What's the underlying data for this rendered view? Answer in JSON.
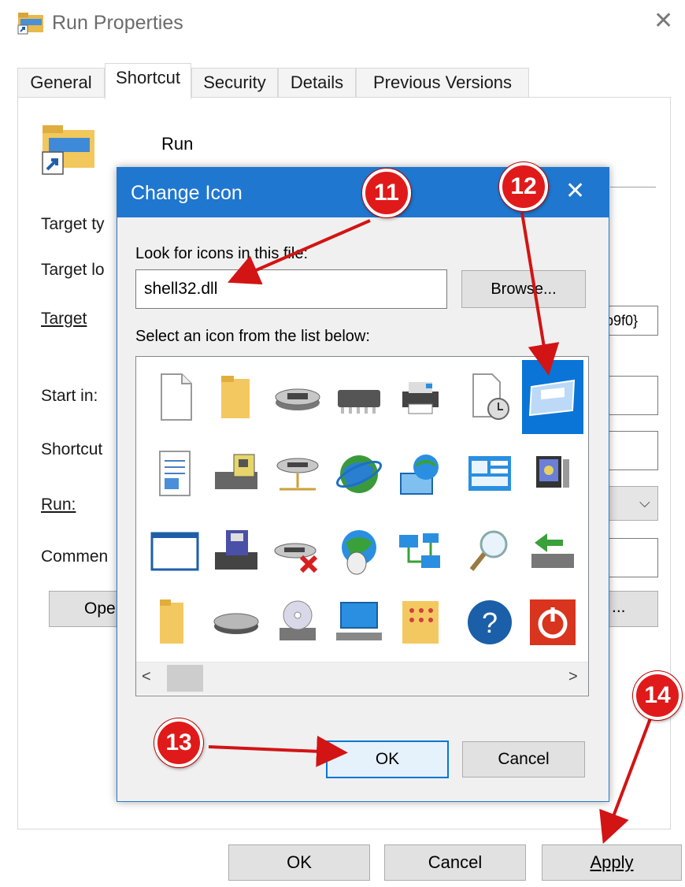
{
  "window": {
    "title": "Run Properties",
    "close_glyph": "✕",
    "tabs": [
      {
        "label": "General",
        "active": false
      },
      {
        "label": "Shortcut",
        "active": true
      },
      {
        "label": "Security",
        "active": false
      },
      {
        "label": "Details",
        "active": false
      },
      {
        "label": "Previous Versions",
        "active": false
      }
    ],
    "shortcut_name": "Run",
    "fields": {
      "target_type": "Target ty",
      "target_location": "Target lo",
      "target": "Target",
      "start_in": "Start in:",
      "shortcut_key": "Shortcut ",
      "run": "Run:",
      "comment": "Commen"
    },
    "target_value_tail": "b9f0}",
    "open_file_location_btn": "Ope",
    "change_icon_btn_tail": "...",
    "buttons": {
      "ok": "OK",
      "cancel": "Cancel",
      "apply": "Apply"
    }
  },
  "dialog": {
    "title": "Change Icon",
    "close_glyph": "✕",
    "lookfor_label": "Look for icons in this file:",
    "file_value": "shell32.dll",
    "browse_label": "Browse...",
    "select_label": "Select an icon from the list below:",
    "icons": [
      [
        "blank-document-icon",
        "folder-icon",
        "disk-drive-icon",
        "memory-chip-icon",
        "printer-icon",
        "document-clock-icon",
        "window-app-icon"
      ],
      [
        "text-document-icon",
        "floppy-drive-icon",
        "network-drive-icon",
        "globe-icon",
        "network-globe-icon",
        "control-panel-icon",
        "computer-screen-icon"
      ],
      [
        "empty-window-icon",
        "floppy-save-icon",
        "disconnected-drive-icon",
        "internet-mouse-icon",
        "network-connections-icon",
        "magnifier-icon",
        "green-arrow-drive-icon"
      ],
      [
        "folder-tall-icon",
        "flat-drive-icon",
        "cd-drive-icon",
        "monitor-icon",
        "folder-grid-icon",
        "help-icon",
        "power-icon"
      ]
    ],
    "selected_icon": "window-app-icon",
    "scroll_left": "<",
    "scroll_right": ">",
    "ok_label": "OK",
    "cancel_label": "Cancel"
  },
  "annotations": [
    {
      "number": "11",
      "color": "#e01a1a"
    },
    {
      "number": "12",
      "color": "#e01a1a"
    },
    {
      "number": "13",
      "color": "#e01a1a"
    },
    {
      "number": "14",
      "color": "#e01a1a"
    }
  ],
  "colors": {
    "accent": "#1f77cf",
    "selection": "#0a75d6",
    "annotation": "#e01a1a"
  }
}
